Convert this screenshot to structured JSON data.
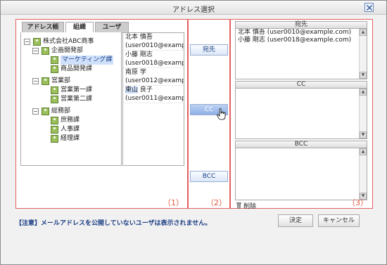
{
  "window": {
    "title": "アドレス選択"
  },
  "tabs": [
    {
      "label": "アドレス帳",
      "active": false
    },
    {
      "label": "組織",
      "active": true
    },
    {
      "label": "ユーザ",
      "active": false
    }
  ],
  "tree": {
    "root": "株式会社ABC商事",
    "nodes": [
      {
        "label": "企画開発部",
        "toggle": "−"
      },
      {
        "label": "マーケティング課",
        "selected": true
      },
      {
        "label": "商品開発課"
      },
      {
        "label": "営業部",
        "toggle": "−"
      },
      {
        "label": "営業第一課"
      },
      {
        "label": "営業第二課"
      },
      {
        "label": "総務部",
        "toggle": "−"
      },
      {
        "label": "庶務課"
      },
      {
        "label": "人事課"
      },
      {
        "label": "経理課"
      }
    ],
    "root_toggle": "−"
  },
  "users": [
    {
      "name": "北本 慎吾",
      "email": "(user0010@examp"
    },
    {
      "name": "小藤 剛志",
      "email": "(user0018@examp"
    },
    {
      "name": "南原 学",
      "email": "(user0012@examp"
    },
    {
      "name_hl": "東山",
      "name_rest": " 良子",
      "email": "(user0011@examp"
    }
  ],
  "transfer": {
    "to_label": "宛先",
    "cc_label": "CC",
    "bcc_label": "BCC"
  },
  "destinations": {
    "to_header": "宛先",
    "to_items": [
      "北本 慎吾 (user0010@example.com)",
      "小藤 剛志 (user0018@example.com)"
    ],
    "cc_header": "CC",
    "bcc_header": "BCC"
  },
  "delete_label": "削除",
  "section_labels": {
    "one": "（1）",
    "two": "（2）",
    "three": "（3）"
  },
  "notice": "【注意】メールアドレスを公開していないユーザは表示されません。",
  "buttons": {
    "ok": "決定",
    "cancel": "キャンセル"
  },
  "scroll_arrows": {
    "up": "▲",
    "down": "▼"
  }
}
